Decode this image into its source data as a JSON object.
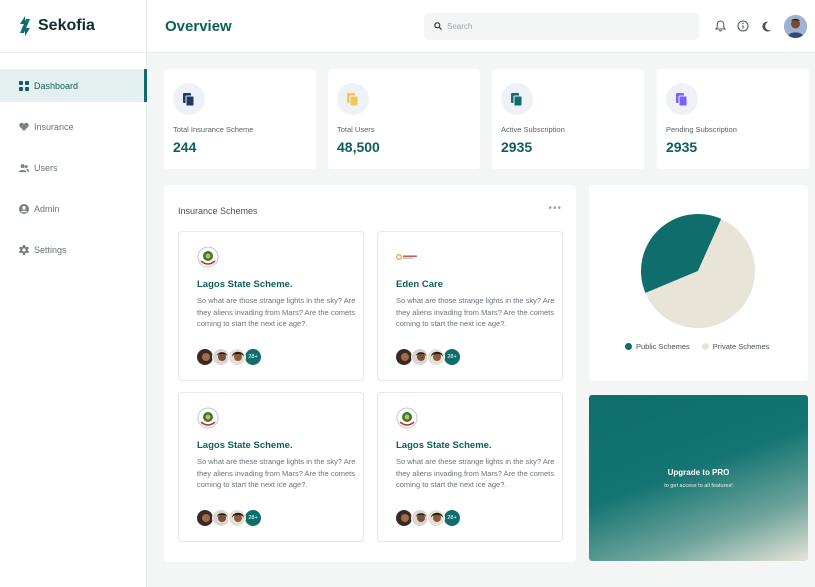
{
  "brand": {
    "name": "Sekofia"
  },
  "sidebar": {
    "items": [
      {
        "label": "Dashboard",
        "icon": "grid-icon",
        "active": true
      },
      {
        "label": "Insurance",
        "icon": "heart-icon",
        "active": false
      },
      {
        "label": "Users",
        "icon": "users-icon",
        "active": false
      },
      {
        "label": "Admin",
        "icon": "user-circle-icon",
        "active": false
      },
      {
        "label": "Settings",
        "icon": "gear-icon",
        "active": false
      }
    ]
  },
  "header": {
    "title": "Overview",
    "search_placeholder": "Search",
    "icons": [
      "bell-icon",
      "info-icon",
      "moon-icon"
    ]
  },
  "stats": [
    {
      "label": "Total Insurance Scheme",
      "value": "244",
      "color": "#1f3a64"
    },
    {
      "label": "Total Users",
      "value": "48,500",
      "color": "#f2c94c"
    },
    {
      "label": "Active Subscription",
      "value": "2935",
      "color": "#0f6e6b"
    },
    {
      "label": "Pending Subscription",
      "value": "2935",
      "color": "#7b61ff"
    }
  ],
  "schemes": {
    "title": "Insurance Schemes",
    "more": "•••",
    "cards": [
      {
        "title": "Lagos State Scheme.",
        "desc": "So what are those strange lights in the sky? Are they aliens invading from Mars? Are the comets coming to start the next ice age?.",
        "more": "28+"
      },
      {
        "title": "Eden Care",
        "desc": "So what are those strange lights in the sky? Are they aliens invading from Mars? Are the comets coming to start the next ice age?.",
        "more": "28+"
      },
      {
        "title": "Lagos State Scheme.",
        "desc": "So what are these strange lights in the sky? Are they aliens invading from Mars? Are the comets coming to start the next ice age?.",
        "more": "28+"
      },
      {
        "title": "Lagos State Scheme.",
        "desc": "So what are these strange lights in the sky? Are they aliens invading from Mars? Are the comets coming to start the next ice age?.",
        "more": "28+"
      }
    ]
  },
  "pie": {
    "legend": [
      {
        "label": "Public Schemes",
        "color": "#0f6e6b"
      },
      {
        "label": "Private Schemes",
        "color": "#e8e4d8"
      }
    ]
  },
  "chart_data": {
    "type": "pie",
    "categories": [
      "Public Schemes",
      "Private Schemes"
    ],
    "values": [
      38,
      62
    ],
    "colors": [
      "#0f6e6b",
      "#e8e4d8"
    ]
  },
  "upgrade": {
    "title": "Upgrade to PRO",
    "subtitle": "to get access to all features!"
  },
  "colors": {
    "accent": "#0f6e6b",
    "accent_text": "#0f5e5c"
  }
}
